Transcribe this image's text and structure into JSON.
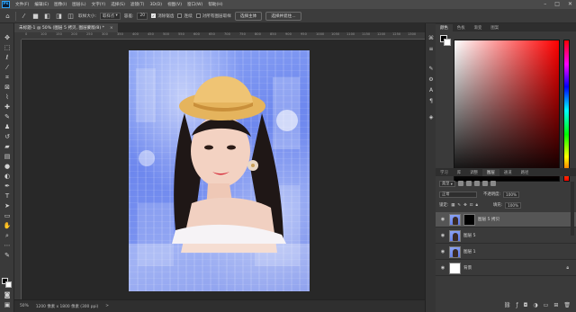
{
  "app": {
    "logo": "Ps"
  },
  "menubar": {
    "items": [
      "文件(F)",
      "编辑(E)",
      "图像(I)",
      "图层(L)",
      "文字(Y)",
      "选择(S)",
      "滤镜(T)",
      "3D(D)",
      "视图(V)",
      "窗口(W)",
      "帮助(H)"
    ],
    "window_controls": [
      "–",
      "□",
      "✕"
    ]
  },
  "options_bar": {
    "sample_label": "取样大小:",
    "sample_value": "取样点",
    "tolerance_label": "容差:",
    "tolerance_value": "20",
    "antialias_label": "消除锯齿",
    "antialias_checked": true,
    "contiguous_label": "连续",
    "contiguous_checked": false,
    "all_layers_label": "对所有图层取样",
    "all_layers_checked": false,
    "select_subject": "选择主体",
    "select_and_mask": "选择并遮住..."
  },
  "document_tab": {
    "title": "未标题-1 @ 50% (图层 5 拷贝, 图层蒙版/8) *",
    "close": "×"
  },
  "ruler_h_ticks": [
    "0",
    "100",
    "150",
    "200",
    "250",
    "300",
    "350",
    "400",
    "450",
    "500",
    "550",
    "600",
    "650",
    "700",
    "750",
    "800",
    "850",
    "900",
    "950",
    "1000",
    "1050",
    "1100",
    "1150",
    "1200",
    "1250",
    "1300"
  ],
  "status_bar": {
    "zoom": "50%",
    "doc_info": "1200 像素 x 1800 像素 (300 ppi)",
    "arrow": ">"
  },
  "color_panel": {
    "tabs": [
      "颜色",
      "色板",
      "渐变",
      "图案"
    ],
    "active_tab": 0,
    "foreground": "#000000",
    "background": "#ffffff"
  },
  "layers_panel": {
    "tabs": [
      "学习",
      "库",
      "调整",
      "图层",
      "通道",
      "路径"
    ],
    "active_tab": 3,
    "filter_label": "类型",
    "blend_mode": "正常",
    "opacity_label": "不透明度:",
    "opacity_value": "100%",
    "lock_label": "锁定:",
    "fill_label": "填充:",
    "fill_value": "100%",
    "layers": [
      {
        "name": "图层 5 拷贝",
        "visible": true,
        "selected": true,
        "thumb": "photo",
        "mask": true
      },
      {
        "name": "图层 5",
        "visible": true,
        "selected": false,
        "thumb": "photo",
        "mask": false
      },
      {
        "name": "图层 1",
        "visible": true,
        "selected": false,
        "thumb": "photo",
        "mask": false
      },
      {
        "name": "背景",
        "visible": true,
        "selected": false,
        "thumb": "white",
        "mask": false,
        "locked": true
      }
    ],
    "footer_icons": [
      "link-icon",
      "fx-icon",
      "mask-icon",
      "adjustment-icon",
      "group-icon",
      "new-layer-icon",
      "trash-icon"
    ]
  },
  "colors": {
    "accent": "#31a8ff",
    "canvas_blue": "#6d87ee"
  }
}
